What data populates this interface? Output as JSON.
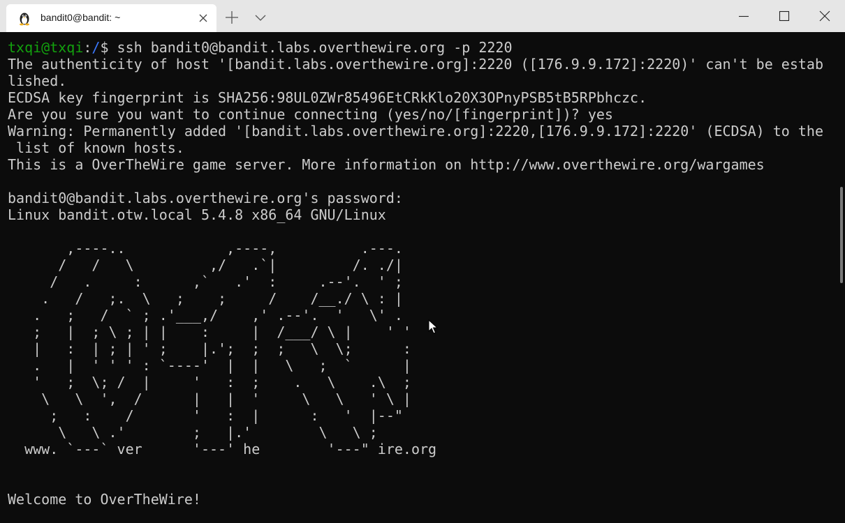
{
  "tab": {
    "title": "bandit0@bandit: ~",
    "icon": "linux-penguin-icon"
  },
  "titlebar_buttons": {
    "new_tab_icon": "plus-icon",
    "dropdown_icon": "chevron-down-icon",
    "minimize_icon": "minimize-icon",
    "maximize_icon": "maximize-icon",
    "close_icon": "close-icon"
  },
  "colors": {
    "terminal_bg": "#0c0c0c",
    "terminal_fg": "#cccccc",
    "prompt_user": "#13a10e",
    "prompt_path": "#3b78ff",
    "titlebar_bg": "#e6e6e6",
    "tab_bg": "#ffffff"
  },
  "prompt": {
    "user_host": "txqi@txqi",
    "separator": ":",
    "path": "/",
    "symbol": "$",
    "command": " ssh bandit0@bandit.labs.overthewire.org -p 2220"
  },
  "lines": [
    "",
    "The authenticity of host '[bandit.labs.overthewire.org]:2220 ([176.9.9.172]:2220)' can't be estab",
    "lished.",
    "ECDSA key fingerprint is SHA256:98UL0ZWr85496EtCRkKlo20X3OPnyPSB5tB5RPbhczc.",
    "Are you sure you want to continue connecting (yes/no/[fingerprint])? yes",
    "Warning: Permanently added '[bandit.labs.overthewire.org]:2220,[176.9.9.172]:2220' (ECDSA) to the",
    " list of known hosts.",
    "This is a OverTheWire game server. More information on http://www.overthewire.org/wargames",
    "",
    "bandit0@bandit.labs.overthewire.org's password:",
    "Linux bandit.otw.local 5.4.8 x86_64 GNU/Linux",
    "",
    "       ,----..            ,----,          .---.",
    "      /   /   \\         ,/   .`|         /. ./|",
    "     /   .     :      ,`   .'  :     .--'.  ' ;",
    "    .   /   ;.  \\   ;    ;     /    /__./ \\ : |",
    "   .   ;   /  ` ; .'___,/    ,' .--'.  '   \\' .",
    "   ;   |  ; \\ ; | |    :     |  /___/ \\ |    ' '",
    "   |   :  | ; | ' ;    |.';  ;  ;   \\  \\;      :",
    "   .   |  ' ' ' : `----'  |  |   \\   ;  `      |",
    "   '   ;  \\; /  |     '   :  ;    .   \\    .\\  ;",
    "    \\   \\  ',  /      |   |  '     \\   \\   ' \\ |",
    "     ;   :    /       '   :  |      :   '  |--\"",
    "      \\   \\ .'        ;   |.'        \\   \\ ;",
    "  www. `---` ver      '---' he        '---\" ire.org",
    "",
    "",
    "Welcome to OverTheWire!"
  ]
}
